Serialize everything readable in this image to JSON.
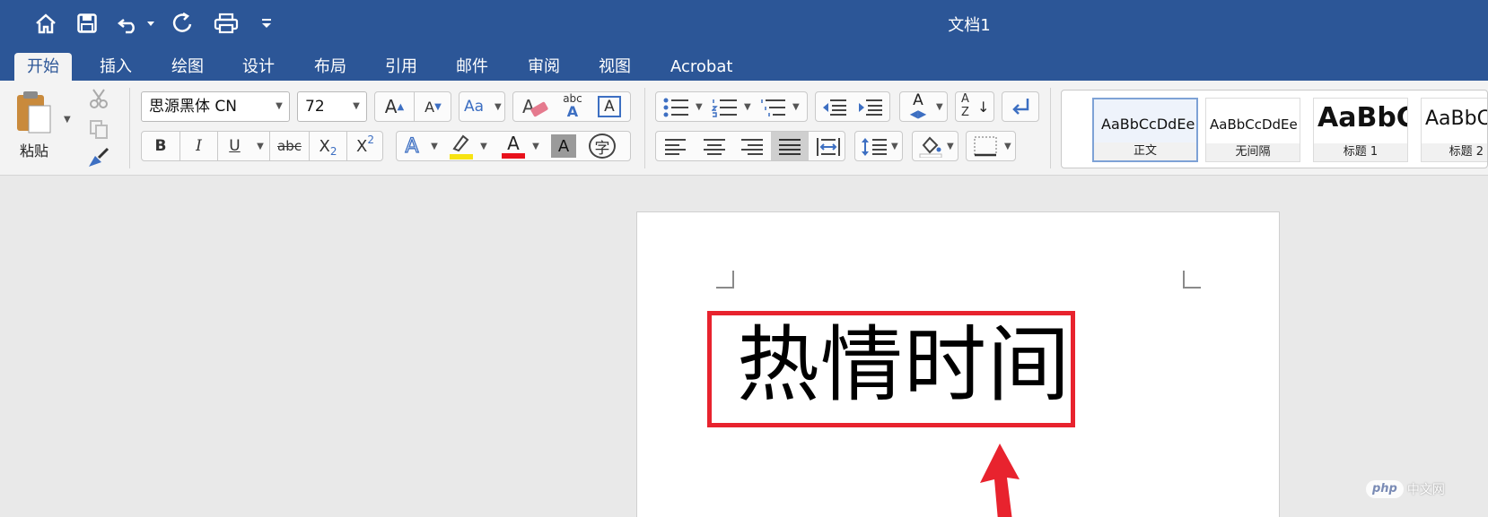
{
  "window": {
    "title": "文档1"
  },
  "tabs": [
    {
      "label": "开始",
      "active": true
    },
    {
      "label": "插入"
    },
    {
      "label": "绘图"
    },
    {
      "label": "设计"
    },
    {
      "label": "布局"
    },
    {
      "label": "引用"
    },
    {
      "label": "邮件"
    },
    {
      "label": "审阅"
    },
    {
      "label": "视图"
    },
    {
      "label": "Acrobat"
    }
  ],
  "clipboard": {
    "paste_label": "粘贴"
  },
  "font": {
    "family": "思源黑体 CN",
    "size": "72",
    "bold": "B",
    "italic": "I",
    "underline": "U",
    "strikethrough": "abc",
    "subscript": "X",
    "subscript_mark": "2",
    "superscript": "X",
    "superscript_mark": "2",
    "grow": "A",
    "shrink": "A",
    "change_case": "Aa",
    "clear_format": "A",
    "phonetic_top": "abc",
    "phonetic_bottom": "A",
    "border_char": "A",
    "text_effect": "A",
    "font_color": "A",
    "char_shading": "A",
    "enclose_char": "字",
    "highlight_color": "#f7e312",
    "font_color_value": "#e8111b"
  },
  "paragraph": {
    "direction": "A",
    "sort_a": "A",
    "sort_z": "Z"
  },
  "styles": [
    {
      "sample": "AaBbCcDdEe",
      "name": "正文",
      "selected": true
    },
    {
      "sample": "AaBbCcDdEe",
      "name": "无间隔"
    },
    {
      "sample": "AaBbC",
      "name": "标题 1"
    },
    {
      "sample": "AaBbC",
      "name": "标题 2"
    }
  ],
  "document": {
    "text": "热情时间"
  },
  "watermark": {
    "badge": "php",
    "text": "中文网"
  },
  "colors": {
    "accent": "#2c5697",
    "annotation": "#e8232e"
  }
}
